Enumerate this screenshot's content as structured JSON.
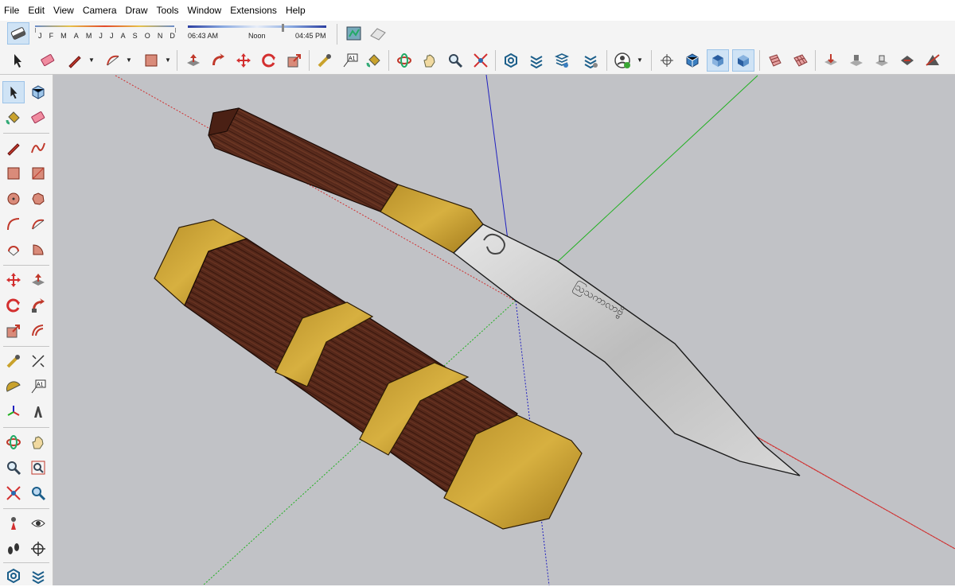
{
  "menu": [
    "File",
    "Edit",
    "View",
    "Camera",
    "Draw",
    "Tools",
    "Window",
    "Extensions",
    "Help"
  ],
  "shadow": {
    "months": [
      "J",
      "F",
      "M",
      "A",
      "M",
      "J",
      "J",
      "A",
      "S",
      "O",
      "N",
      "D"
    ],
    "time_start": "06:43 AM",
    "time_mid": "Noon",
    "time_end": "04:45 PM"
  },
  "colors": {
    "viewport_bg": "#c1c2c6",
    "axis_red": "#d03030",
    "axis_green": "#20b020",
    "axis_blue": "#2020c0",
    "wood": "#5a2a1c",
    "brass": "#c9a22c",
    "steel": "#cfcfcf"
  },
  "icons": {
    "toolbar_shadow": [
      "eraser-icon"
    ],
    "toolbar_main": [
      "select-icon",
      "eraser-icon",
      "pencil-icon",
      "arc-icon",
      "rectangle-icon",
      "push-pull-icon",
      "follow-me-icon",
      "move-icon",
      "rotate-icon",
      "scale-icon",
      "tape-measure-icon",
      "text-icon",
      "paint-bucket-icon",
      "orbit-icon",
      "pan-icon",
      "zoom-icon",
      "zoom-extents-icon",
      "warehouse-icon",
      "extension-warehouse-icon",
      "layer-manager-icon",
      "components-icon",
      "account-icon",
      "xray-icon",
      "iso-view-icon",
      "top-view-icon",
      "front-view-icon",
      "sandbox-from-contours-icon",
      "sandbox-from-scratch-icon",
      "smoove-icon",
      "stamp-icon",
      "drape-icon",
      "add-detail-icon",
      "flip-edge-icon"
    ]
  },
  "blade_engraving": "ဩသကာလာဗ္ဗိ"
}
